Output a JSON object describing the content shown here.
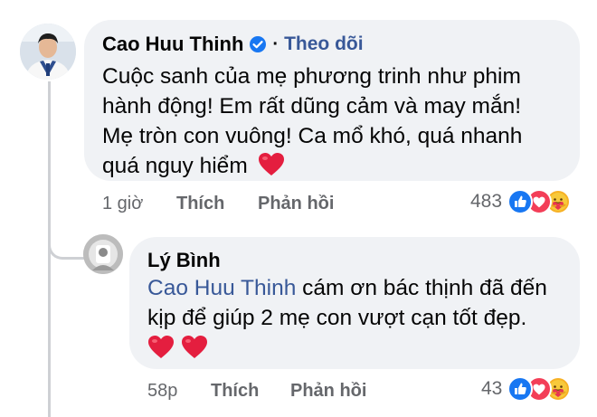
{
  "comment": {
    "author": "Cao Huu Thinh",
    "separator": "·",
    "follow_label": "Theo dõi",
    "text": "Cuộc sanh của mẹ phương trinh như phim hành động! Em rất dũng cảm và may mắn! Mẹ tròn con vuông! Ca mổ khó, quá nhanh quá nguy hiểm",
    "time": "1 giờ",
    "like_label": "Thích",
    "reply_label": "Phản hồi",
    "reaction_count": "483",
    "reaction_icons": [
      "like-icon",
      "love-icon",
      "care-icon"
    ]
  },
  "reply": {
    "author": "Lý Bình",
    "mention": "Cao Huu Thinh",
    "text": " cám ơn bác thịnh đã đến kịp để giúp 2 mẹ con vượt cạn tốt đẹp.",
    "time": "58p",
    "like_label": "Thích",
    "reply_label": "Phản hồi",
    "reaction_count": "43",
    "reaction_icons": [
      "like-icon",
      "love-icon",
      "care-icon"
    ]
  },
  "colors": {
    "bubble": "#f0f2f5",
    "link": "#385898",
    "verified": "#1877f2",
    "heart": "#e41e3f",
    "meta": "#65676b"
  }
}
